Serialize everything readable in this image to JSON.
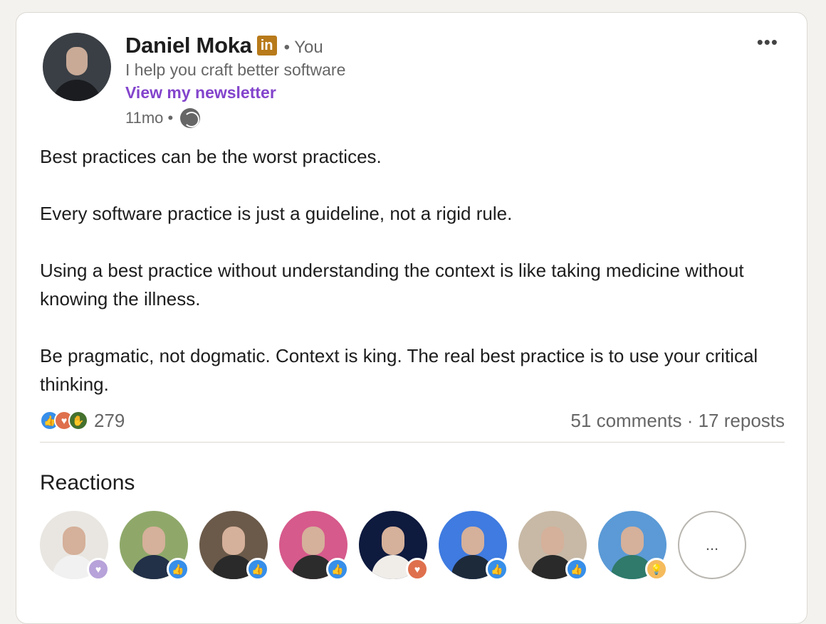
{
  "author": {
    "name": "Daniel Moka",
    "badge_text": "in",
    "relation": "• You",
    "headline": "I help you craft better software",
    "newsletter_link": "View my newsletter",
    "time": "11mo •"
  },
  "post": {
    "paragraphs": [
      "Best practices can be the worst practices.",
      "Every software practice is just a guideline, not a rigid rule.",
      "Using a best practice without understanding the context is like taking medicine without knowing the illness.",
      "Be pragmatic, not dogmatic. Context is king. The real best practice is to use your critical thinking."
    ]
  },
  "social": {
    "reaction_count": "279",
    "comments_reposts": "51 comments · 17 reposts",
    "reaction_icons": [
      "like-icon",
      "love-icon",
      "celebrate-icon"
    ]
  },
  "reactions_section": {
    "heading": "Reactions",
    "more_label": "...",
    "people": [
      {
        "bg": "#e9e6e1",
        "shirt": "#f1f1f1",
        "badge": "support"
      },
      {
        "bg": "#8fa86a",
        "shirt": "#223048",
        "badge": "like"
      },
      {
        "bg": "#6b5a4a",
        "shirt": "#2a2a2a",
        "badge": "like"
      },
      {
        "bg": "#d65a8c",
        "shirt": "#2c2c2c",
        "badge": "like"
      },
      {
        "bg": "#0e1a3e",
        "shirt": "#f0ece8",
        "badge": "love"
      },
      {
        "bg": "#3f7be0",
        "shirt": "#1d2a3a",
        "badge": "like"
      },
      {
        "bg": "#c7b9a6",
        "shirt": "#2a2a2a",
        "badge": "like"
      },
      {
        "bg": "#5b9ad6",
        "shirt": "#2f7a6a",
        "badge": "insight"
      }
    ]
  },
  "colors": {
    "newsletter": "#8344cc",
    "like": "#378fe9",
    "love": "#df704d",
    "celebrate": "#44712e",
    "insight": "#f5bb5c"
  }
}
